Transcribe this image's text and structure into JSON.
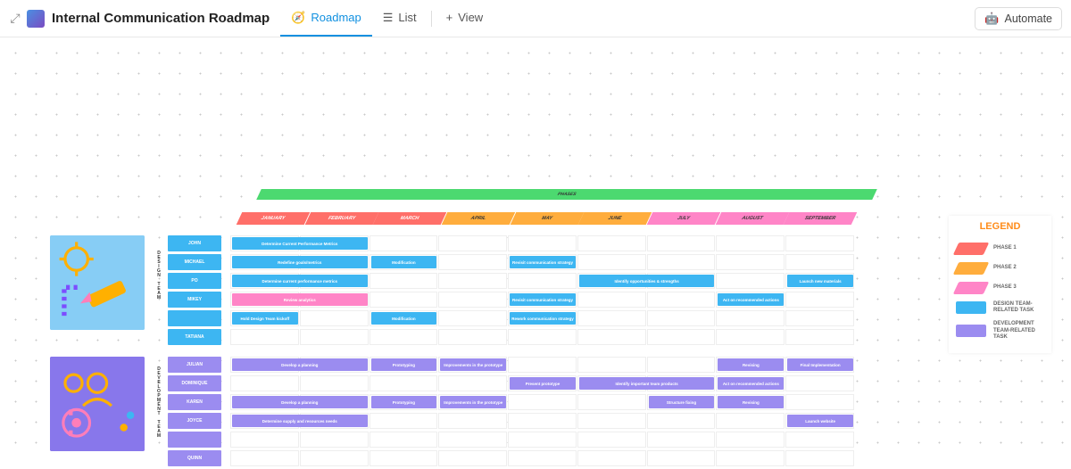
{
  "header": {
    "title": "Internal Communication Roadmap",
    "views": {
      "roadmap": "Roadmap",
      "list": "List",
      "add": "View"
    },
    "automate": "Automate"
  },
  "phases_band": "PHASES",
  "months": [
    {
      "label": "JANUARY",
      "color": "c-red"
    },
    {
      "label": "FEBRUARY",
      "color": "c-red"
    },
    {
      "label": "MARCH",
      "color": "c-red"
    },
    {
      "label": "APRIL",
      "color": "c-orange"
    },
    {
      "label": "MAY",
      "color": "c-orange"
    },
    {
      "label": "JUNE",
      "color": "c-orange"
    },
    {
      "label": "JULY",
      "color": "c-pink"
    },
    {
      "label": "AUGUST",
      "color": "c-pink"
    },
    {
      "label": "SEPTEMBER",
      "color": "c-pink"
    }
  ],
  "legend": {
    "title": "LEGEND",
    "items": [
      {
        "color": "c-red",
        "skew": true,
        "label": "PHASE 1"
      },
      {
        "color": "c-orange",
        "skew": true,
        "label": "PHASE 2"
      },
      {
        "color": "c-pink",
        "skew": true,
        "label": "PHASE 3"
      },
      {
        "color": "c-blue",
        "skew": false,
        "label": "DESIGN TEAM-RELATED TASK"
      },
      {
        "color": "c-purple",
        "skew": false,
        "label": "DEVELOPMENT TEAM-RELATED TASK"
      }
    ]
  },
  "design_team": {
    "vlabel": "DESIGN TEAM",
    "names": [
      "JOHN",
      "MICHAEL",
      "PO",
      "MIKEY",
      "",
      "TATIANA"
    ]
  },
  "dev_team": {
    "vlabel": "DEVELOPMENT TEAM",
    "names": [
      "JULIAN",
      "DOMINIQUE",
      "KAREN",
      "JOYCE",
      "",
      "QUINN"
    ]
  },
  "design_rows": [
    [
      {
        "label": "Determine Current Performance Metrics",
        "start": 0,
        "span": 2,
        "color": "c-blue"
      }
    ],
    [
      {
        "label": "Redefine goals/metrics",
        "start": 0,
        "span": 2,
        "color": "c-blue"
      },
      {
        "label": "Modification",
        "start": 2,
        "span": 1,
        "color": "c-blue"
      },
      {
        "label": "Revisit communication strategy",
        "start": 4,
        "span": 1,
        "color": "c-blue"
      }
    ],
    [
      {
        "label": "Determine current performance metrics",
        "start": 0,
        "span": 2,
        "color": "c-blue"
      },
      {
        "label": "Identify opportunities & strengths",
        "start": 5,
        "span": 2,
        "color": "c-blue"
      },
      {
        "label": "Launch new materials",
        "start": 8,
        "span": 1,
        "color": "c-blue"
      }
    ],
    [
      {
        "label": "Review analytics",
        "start": 0,
        "span": 2,
        "color": "c-pink"
      },
      {
        "label": "Revisit communication strategy",
        "start": 4,
        "span": 1,
        "color": "c-blue"
      },
      {
        "label": "Act on recommended actions",
        "start": 7,
        "span": 1,
        "color": "c-blue"
      }
    ],
    [
      {
        "label": "Hold Design Team kickoff",
        "start": 0,
        "span": 1,
        "color": "c-blue"
      },
      {
        "label": "Modification",
        "start": 2,
        "span": 1,
        "color": "c-blue"
      },
      {
        "label": "Rework communication strategy",
        "start": 4,
        "span": 1,
        "color": "c-blue"
      }
    ],
    []
  ],
  "dev_rows": [
    [
      {
        "label": "Develop a planning",
        "start": 0,
        "span": 2,
        "color": "c-purple"
      },
      {
        "label": "Prototyping",
        "start": 2,
        "span": 1,
        "color": "c-purple"
      },
      {
        "label": "Improvements in the prototype",
        "start": 3,
        "span": 1,
        "color": "c-purple"
      },
      {
        "label": "Revising",
        "start": 7,
        "span": 1,
        "color": "c-purple"
      },
      {
        "label": "Final Implementation",
        "start": 8,
        "span": 1,
        "color": "c-purple"
      }
    ],
    [
      {
        "label": "Present prototype",
        "start": 4,
        "span": 1,
        "color": "c-purple"
      },
      {
        "label": "Identify important team products",
        "start": 5,
        "span": 2,
        "color": "c-purple"
      },
      {
        "label": "Act on recommended actions",
        "start": 7,
        "span": 1,
        "color": "c-purple"
      }
    ],
    [
      {
        "label": "Develop a planning",
        "start": 0,
        "span": 2,
        "color": "c-purple"
      },
      {
        "label": "Prototyping",
        "start": 2,
        "span": 1,
        "color": "c-purple"
      },
      {
        "label": "Improvements in the prototype",
        "start": 3,
        "span": 1,
        "color": "c-purple"
      },
      {
        "label": "Structure fixing",
        "start": 6,
        "span": 1,
        "color": "c-purple"
      },
      {
        "label": "Revising",
        "start": 7,
        "span": 1,
        "color": "c-purple"
      }
    ],
    [
      {
        "label": "Determine supply and resources needs",
        "start": 0,
        "span": 2,
        "color": "c-purple"
      },
      {
        "label": "Launch website",
        "start": 8,
        "span": 1,
        "color": "c-purple"
      }
    ],
    [],
    []
  ],
  "colors": {
    "red": "#ff6f69",
    "orange": "#ffad3d",
    "pink": "#ff85c7",
    "blue": "#3db6f2",
    "purple": "#9b8cf0",
    "green": "#4cd970"
  }
}
